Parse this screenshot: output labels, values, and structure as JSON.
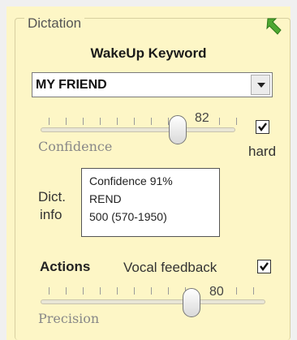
{
  "group_title": "Dictation",
  "wakeup": {
    "title": "WakeUp Keyword",
    "selected": "MY FRIEND"
  },
  "confidence": {
    "label": "Confidence",
    "value": "82",
    "hard_label": "hard",
    "hard_checked": true
  },
  "dict_info": {
    "label_line1": "Dict.",
    "label_line2": "info",
    "lines": [
      "Confidence 91%",
      "REND",
      "500 (570-1950)"
    ]
  },
  "actions": {
    "label": "Actions",
    "vocal_feedback_label": "Vocal feedback",
    "vocal_feedback_checked": true
  },
  "precision": {
    "label": "Precision",
    "value": "80"
  },
  "colors": {
    "panel_bg": "#fdf6c6",
    "corner_icon": "#4ea832"
  },
  "icons": {
    "corner": "green-arrow-icon",
    "dropdown": "chevron-down-icon"
  }
}
